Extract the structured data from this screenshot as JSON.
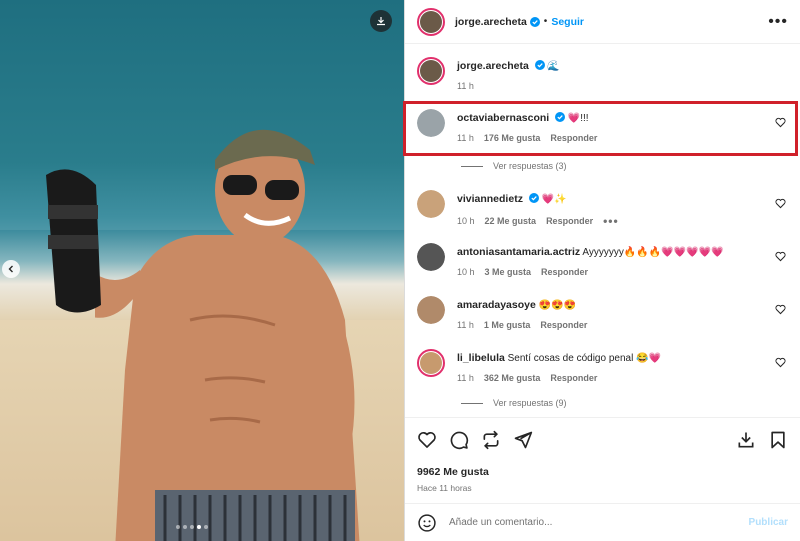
{
  "post": {
    "author": "jorge.arecheta",
    "follow_label": "Seguir",
    "more_label": "•••",
    "caption_author": "jorge.arecheta",
    "caption_text": "🌊",
    "caption_time": "11 h",
    "carousel_dots": 5,
    "carousel_active": 4
  },
  "comments": [
    {
      "user": "octaviabernasconi",
      "verified": true,
      "text": "💗!!!",
      "time": "11 h",
      "likes": "176 Me gusta",
      "reply": "Responder",
      "avatar_color": "#9aa3a8"
    },
    {
      "user": "viviannedietz",
      "verified": true,
      "text": "💗✨",
      "time": "10 h",
      "likes": "22 Me gusta",
      "reply": "Responder",
      "avatar_color": "#c9a27a"
    },
    {
      "user": "antoniasantamaria.actriz",
      "verified": false,
      "text": "Ayyyyyyy🔥🔥🔥💗💗💗💗💗",
      "time": "10 h",
      "likes": "3 Me gusta",
      "reply": "Responder",
      "avatar_color": "#555"
    },
    {
      "user": "amaradayasoye",
      "verified": false,
      "text": "😍😍😍",
      "time": "11 h",
      "likes": "1 Me gusta",
      "reply": "Responder",
      "avatar_color": "#b08a6a"
    },
    {
      "user": "li_libelula",
      "verified": false,
      "text": "Sentí cosas de código penal 😂💗",
      "time": "11 h",
      "likes": "362 Me gusta",
      "reply": "Responder",
      "avatar_color": "#c79a6e"
    }
  ],
  "view_replies_1": "Ver respuestas (3)",
  "view_replies_2": "Ver respuestas (9)",
  "likes_count": "9962 Me gusta",
  "post_date": "Hace 11 horas",
  "comment_placeholder": "Añade un comentario...",
  "publish_label": "Publicar",
  "colors": {
    "accent": "#0095f6",
    "highlight": "#d0202a",
    "publish": "#b2dffc"
  }
}
